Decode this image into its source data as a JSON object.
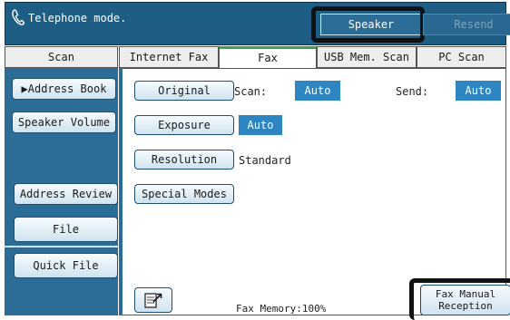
{
  "status": {
    "text": "Telephone mode.",
    "speaker_label": "Speaker",
    "resend_label": "Resend"
  },
  "tabs": [
    {
      "label": "Scan"
    },
    {
      "label": "Internet Fax"
    },
    {
      "label": "Fax",
      "active": true
    },
    {
      "label": "USB Mem. Scan"
    },
    {
      "label": "PC Scan"
    }
  ],
  "sidebar": {
    "address_book": "▶Address Book",
    "speaker_volume": "Speaker Volume",
    "address_review": "Address Review",
    "file": "File",
    "quick_file": "Quick File"
  },
  "settings": {
    "original_label": "Original",
    "scan_label": "Scan:",
    "scan_value": "Auto",
    "send_label": "Send:",
    "send_value": "Auto",
    "exposure_label": "Exposure",
    "exposure_value": "Auto",
    "resolution_label": "Resolution",
    "resolution_value": "Standard",
    "special_modes_label": "Special Modes"
  },
  "footer": {
    "fax_memory": "Fax Memory:100%",
    "fax_manual_reception": [
      "Fax Manual",
      "Reception"
    ]
  },
  "colors": {
    "status_bar": "#1f5e84",
    "panel_blue": "#2b6d97",
    "value_blue": "#2d86c2",
    "active_tab_accent": "#3aa34f"
  },
  "icons": {
    "phone": "phone-handset-icon",
    "page": "page-arrow-icon"
  }
}
